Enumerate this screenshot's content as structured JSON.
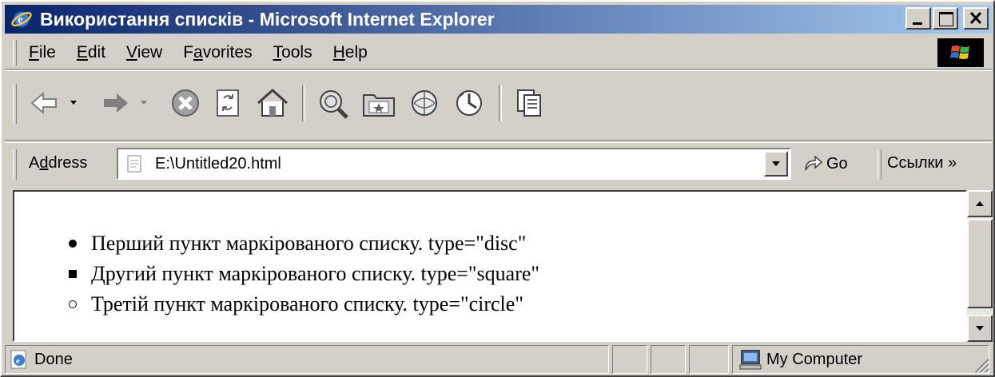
{
  "window": {
    "title": "Використання списків - Microsoft Internet Explorer"
  },
  "menu": {
    "items": [
      {
        "label": "File",
        "accel": "F",
        "rest": "ile"
      },
      {
        "label": "Edit",
        "accel": "E",
        "rest": "dit"
      },
      {
        "label": "View",
        "accel": "V",
        "rest": "iew"
      },
      {
        "label": "Favorites",
        "pre": "F",
        "accel": "a",
        "rest": "vorites"
      },
      {
        "label": "Tools",
        "accel": "T",
        "rest": "ools"
      },
      {
        "label": "Help",
        "accel": "H",
        "rest": "elp"
      }
    ]
  },
  "toolbar": {
    "icons": [
      "back-icon",
      "forward-icon",
      "stop-icon",
      "refresh-icon",
      "home-icon",
      "search-icon",
      "favorites-icon",
      "history-icon",
      "mail-icon",
      "print-icon"
    ]
  },
  "address": {
    "label_pre": "A",
    "label_accel": "d",
    "label_rest": "dress",
    "value": "E:\\Untitled20.html",
    "go_label": "Go",
    "links_label": "Ссылки »"
  },
  "content": {
    "items": [
      {
        "bullet": "disc",
        "text": "Перший пункт маркірованого списку. type=\"disc\""
      },
      {
        "bullet": "square",
        "text": "Другий пункт маркірованого списку. type=\"square\""
      },
      {
        "bullet": "circle",
        "text": "Третій пункт маркірованого списку. type=\"circle\""
      }
    ]
  },
  "status": {
    "text": "Done",
    "zone": "My Computer"
  },
  "colors": {
    "titlebar_start": "#0a246a",
    "titlebar_end": "#a6caf0",
    "chrome": "#d4d0c8"
  }
}
